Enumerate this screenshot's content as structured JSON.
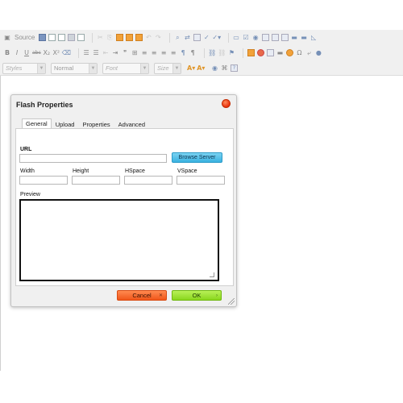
{
  "toolbar": {
    "row1": {
      "source_label": "Source"
    },
    "row3": {
      "styles_placeholder": "Styles",
      "format_value": "Normal",
      "font_placeholder": "Font",
      "size_placeholder": "Size"
    }
  },
  "dialog": {
    "title": "Flash Properties",
    "tabs": [
      "General",
      "Upload",
      "Properties",
      "Advanced"
    ],
    "active_tab": "General",
    "url_label": "URL",
    "url_value": "",
    "browse_label": "Browse Server",
    "width_label": "Width",
    "height_label": "Height",
    "hspace_label": "HSpace",
    "vspace_label": "VSpace",
    "preview_label": "Preview",
    "cancel_label": "Cancel",
    "ok_label": "OK"
  },
  "colors": {
    "cancel": "#f0561a",
    "ok": "#8ad61e",
    "browse": "#3ab2e0",
    "close": "#e8300c"
  }
}
